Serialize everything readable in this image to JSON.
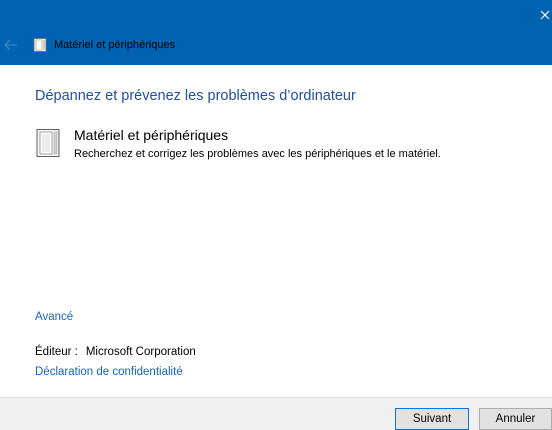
{
  "window": {
    "title": "Matériel et périphériques"
  },
  "content": {
    "heading": "Dépannez et prévenez les problèmes d’ordinateur",
    "item": {
      "title": "Matériel et périphériques",
      "description": "Recherchez et corrigez les problèmes avec les périphériques et le matériel."
    },
    "advanced_link": "Avancé",
    "publisher_label": "Éditeur :",
    "publisher_value": "Microsoft Corporation",
    "privacy_link": "Déclaration de confidentialité"
  },
  "footer": {
    "next_label": "Suivant",
    "cancel_label": "Annuler"
  },
  "colors": {
    "titlebar": "#0063b1",
    "link": "#1a62b7",
    "heading": "#234f9c"
  },
  "icons": {
    "title": "hardware-device-icon",
    "item": "hardware-device-icon",
    "back": "back-arrow-icon",
    "close": "close-icon"
  }
}
